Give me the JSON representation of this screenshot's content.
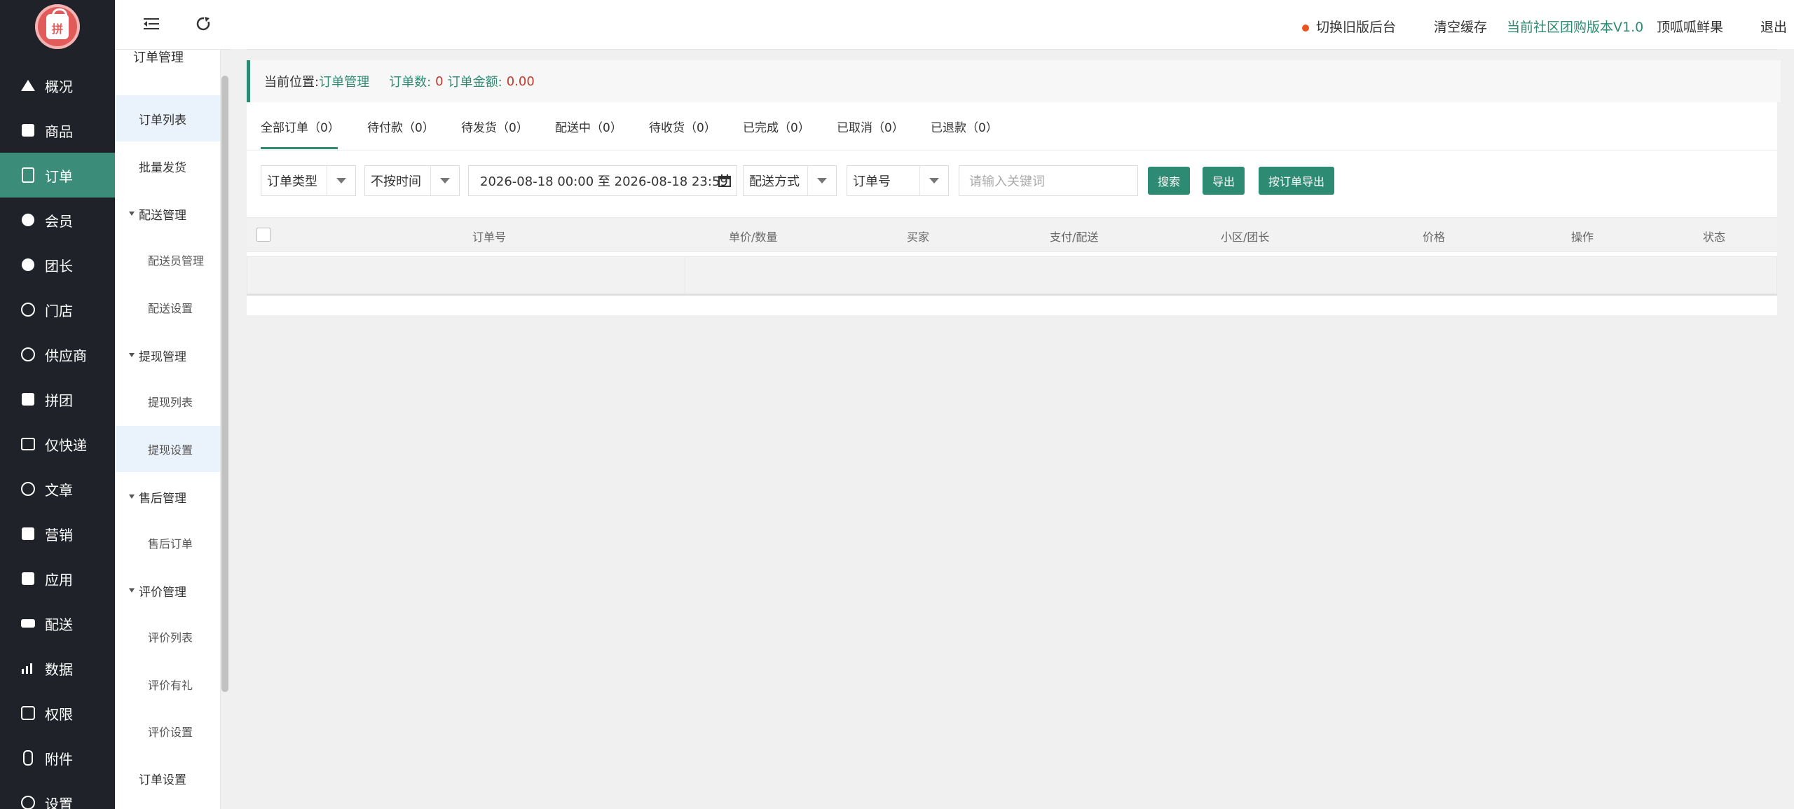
{
  "logo": {
    "text": "拼"
  },
  "nav": [
    {
      "label": "概况",
      "icon": "home-icon"
    },
    {
      "label": "商品",
      "icon": "mail-icon"
    },
    {
      "label": "订单",
      "icon": "document-icon"
    },
    {
      "label": "会员",
      "icon": "users-icon"
    },
    {
      "label": "团长",
      "icon": "crown-icon"
    },
    {
      "label": "门店",
      "icon": "store-user-icon"
    },
    {
      "label": "供应商",
      "icon": "supplier-icon"
    },
    {
      "label": "拼团",
      "icon": "group-icon"
    },
    {
      "label": "仅快递",
      "icon": "express-icon"
    },
    {
      "label": "文章",
      "icon": "compass-icon"
    },
    {
      "label": "营销",
      "icon": "gift-icon"
    },
    {
      "label": "应用",
      "icon": "cube-icon"
    },
    {
      "label": "配送",
      "icon": "truck-icon"
    },
    {
      "label": "数据",
      "icon": "chart-icon"
    },
    {
      "label": "权限",
      "icon": "lock-icon"
    },
    {
      "label": "附件",
      "icon": "paperclip-icon"
    },
    {
      "label": "设置",
      "icon": "settings-icon"
    }
  ],
  "nav_active": "订单",
  "subnav": {
    "header": "订单管理",
    "items": [
      {
        "label": "订单列表"
      },
      {
        "label": "批量发货"
      },
      {
        "label": "配送管理"
      },
      {
        "label": "配送员管理"
      },
      {
        "label": "配送设置"
      },
      {
        "label": "提现管理"
      },
      {
        "label": "提现列表"
      },
      {
        "label": "提现设置"
      },
      {
        "label": "售后管理"
      },
      {
        "label": "售后订单"
      },
      {
        "label": "评价管理"
      },
      {
        "label": "评价列表"
      },
      {
        "label": "评价有礼"
      },
      {
        "label": "评价设置"
      },
      {
        "label": "订单设置"
      }
    ]
  },
  "topbar": {
    "switch_old": "切换旧版后台",
    "clear_cache": "清空缓存",
    "version": "当前社区团购版本V1.0",
    "shop": "顶呱呱鲜果",
    "logout": "退出",
    "status_color": "#e8551e"
  },
  "breadcrumb": {
    "label": "当前位置:",
    "current": "订单管理",
    "order_count_label": "订单数:",
    "order_count": "0",
    "order_amount_label": "订单金额:",
    "order_amount": "0.00"
  },
  "tabs": [
    {
      "label": "全部订单（0）"
    },
    {
      "label": "待付款（0）"
    },
    {
      "label": "待发货（0）"
    },
    {
      "label": "配送中（0）"
    },
    {
      "label": "待收货（0）"
    },
    {
      "label": "已完成（0）"
    },
    {
      "label": "已取消（0）"
    },
    {
      "label": "已退款（0）"
    }
  ],
  "filters": {
    "order_type": "订单类型",
    "time_mode": "不按时间",
    "date_range": "2026-08-18 00:00 至 2026-08-18 23:59",
    "delivery_method": "配送方式",
    "search_field": "订单号",
    "keyword_placeholder": "请输入关键词",
    "search_btn": "搜索",
    "export_btn": "导出",
    "export_by_order_btn": "按订单导出"
  },
  "table": {
    "columns": [
      "订单号",
      "单价/数量",
      "买家",
      "支付/配送",
      "小区/团长",
      "价格",
      "操作",
      "状态"
    ]
  },
  "colors": {
    "accent": "#2e8b73",
    "sidebar_bg": "#1f2329",
    "danger": "#c0392b"
  }
}
